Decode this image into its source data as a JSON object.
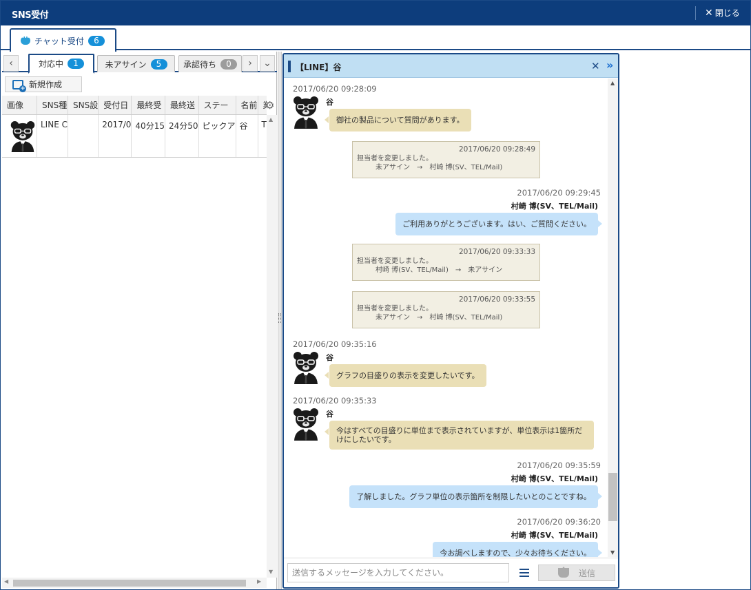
{
  "window": {
    "title": "SNS受付",
    "close_label": "閉じる"
  },
  "main_tab": {
    "label": "チャット受付",
    "count": "6"
  },
  "sub_tabs": [
    {
      "label": "対応中",
      "count": "1"
    },
    {
      "label": "未アサイン",
      "count": "5"
    },
    {
      "label": "承認待ち",
      "count": "0"
    }
  ],
  "toolbar": {
    "new_label": "新規作成"
  },
  "table": {
    "columns": [
      "画像",
      "SNS種",
      "SNS設",
      "受付日",
      "最終受",
      "最終送",
      "ステー",
      "名前",
      "業務"
    ],
    "rows": [
      {
        "image": "",
        "sns_type": "LINE C",
        "sns_setting": "",
        "received": "2017/0",
        "last_recv": "40分15",
        "last_sent": "24分50",
        "status": "ピックア",
        "name": "谷",
        "business": "TMX"
      }
    ]
  },
  "chat": {
    "title": "【LINE】谷",
    "input_placeholder": "送信するメッセージを入力してください。",
    "send_label": "送信",
    "messages": [
      {
        "ts": "2017/06/20 09:28:09",
        "name": "谷",
        "text": "御社の製品について質問があります。"
      },
      {
        "sys_date": "2017/06/20 09:28:49",
        "line1": "担当者を変更しました。",
        "line2": "未アサイン　→　村崎 博(SV、TEL/Mail)"
      },
      {
        "ts": "2017/06/20 09:29:45",
        "name": "村崎 博(SV、TEL/Mail)",
        "text": "ご利用ありがとうございます。はい、ご質問ください。"
      },
      {
        "sys_date": "2017/06/20 09:33:33",
        "line1": "担当者を変更しました。",
        "line2": "村崎 博(SV、TEL/Mail)　→　未アサイン"
      },
      {
        "sys_date": "2017/06/20 09:33:55",
        "line1": "担当者を変更しました。",
        "line2": "未アサイン　→　村崎 博(SV、TEL/Mail)"
      },
      {
        "ts": "2017/06/20 09:35:16",
        "name": "谷",
        "text": "グラフの目盛りの表示を変更したいです。"
      },
      {
        "ts": "2017/06/20 09:35:33",
        "name": "谷",
        "text1": "今はすべての目盛りに単位まで表示されていますが、単位表示は1箇所だ",
        "text2": "けにしたいです。"
      },
      {
        "ts": "2017/06/20 09:35:59",
        "name": "村崎 博(SV、TEL/Mail)",
        "text": "了解しました。グラフ単位の表示箇所を制限したいとのことですね。"
      },
      {
        "ts": "2017/06/20 09:36:20",
        "name": "村崎 博(SV、TEL/Mail)",
        "text": "今お調べしますので、少々お待ちください。"
      }
    ]
  },
  "icons": {
    "avatar": "bear-avatar-icon",
    "chat": "chat-bubble-icon",
    "close": "close-icon",
    "gear": "gear-icon",
    "list": "list-icon",
    "send": "send-icon",
    "expand": "double-chevron-right-icon"
  }
}
